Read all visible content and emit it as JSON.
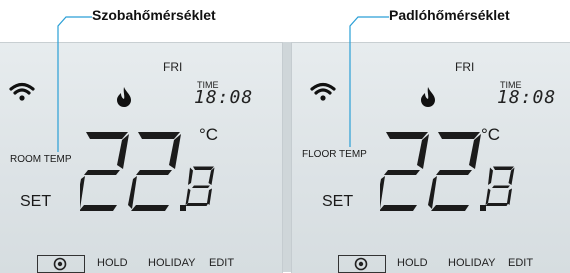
{
  "callouts": {
    "room": "Szobahőmérséklet",
    "floor": "Padlóhőmérséklet"
  },
  "panels": [
    {
      "day": "FRI",
      "time_label": "TIME",
      "time": "18:08",
      "sensor_label": "ROOM TEMP",
      "set_label": "SET",
      "temperature": "22.8",
      "temp_int": "22",
      "temp_dec": "8",
      "unit": "°C",
      "menu": {
        "hold": "HOLD",
        "holiday": "HOLIDAY",
        "edit": "EDIT"
      }
    },
    {
      "day": "FRI",
      "time_label": "TIME",
      "time": "18:08",
      "sensor_label": "FLOOR TEMP",
      "set_label": "SET",
      "temperature": "22.8",
      "temp_int": "22",
      "temp_dec": "8",
      "unit": "°C",
      "menu": {
        "hold": "HOLD",
        "holiday": "HOLIDAY",
        "edit": "EDIT"
      }
    }
  ],
  "icons": [
    "wifi-icon",
    "flame-icon",
    "mode-dial-icon"
  ]
}
